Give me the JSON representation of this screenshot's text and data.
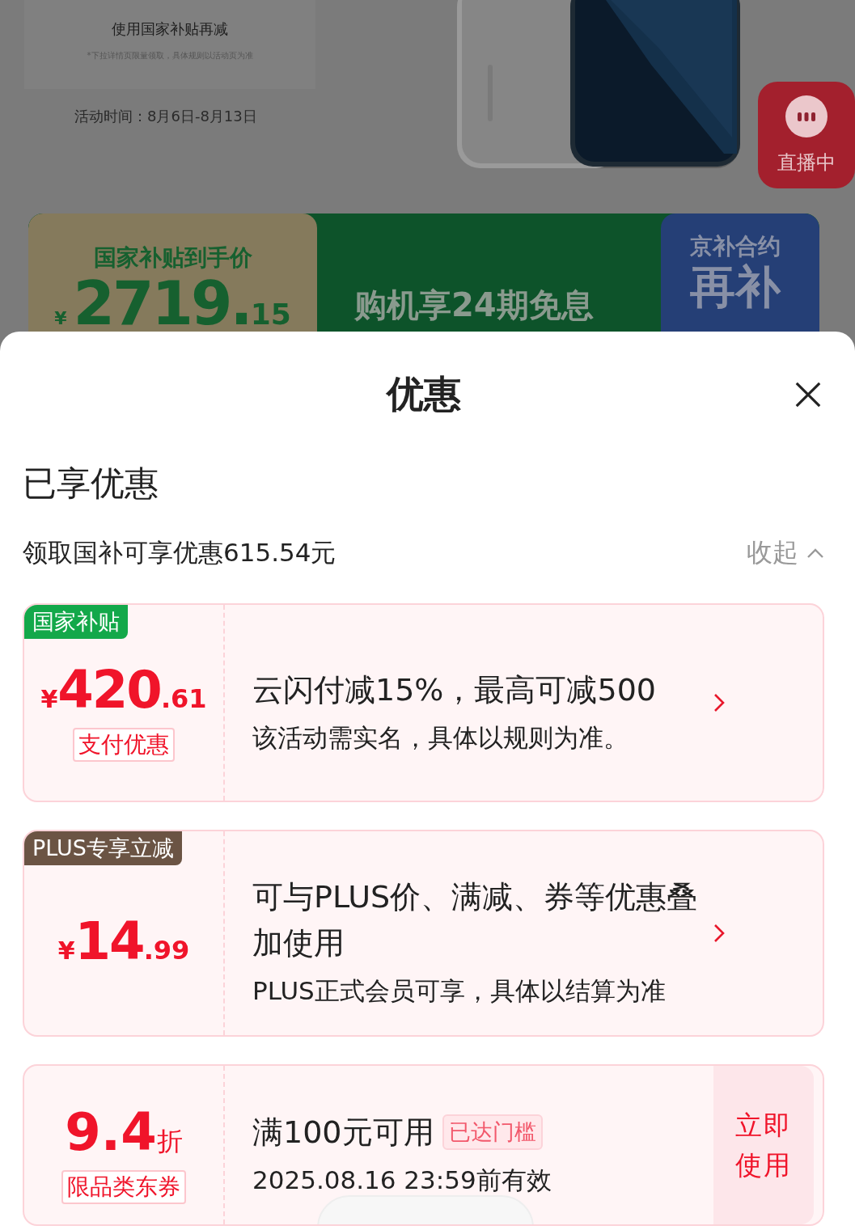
{
  "backdrop": {
    "promo_subtitle": "使用国家补贴再减",
    "promo_note": "*下拉详情页限量领取，具体规则以活动页为准",
    "promo_period": "活动时间：8月6日-8月13日",
    "live_button": {
      "label": "直播中"
    },
    "subsidy_banner": {
      "label": "国家补贴到手价",
      "currency": "¥",
      "price_int": "2719.",
      "price_dec": "15"
    },
    "installment_text": "购机享24期免息",
    "contract_badge": {
      "line1": "京补合约",
      "line2": "再补"
    }
  },
  "sheet": {
    "title": "优惠",
    "section_title": "已享优惠",
    "summary": {
      "text": "领取国补可享优惠615.54元",
      "toggle_label": "收起",
      "expanded": true
    },
    "offers": [
      {
        "tag": "国家补贴",
        "color": "#13a84a",
        "currency": "¥",
        "amount_int": "420",
        "amount_dec": ".61",
        "type_label": "支付优惠",
        "title": "云闪付减15%，最高可减500",
        "subtitle": "该活动需实名，具体以规则为准。"
      },
      {
        "tag": "PLUS专享立减",
        "color": "#6b5444",
        "currency": "¥",
        "amount_int": "14",
        "amount_dec": ".99",
        "title": "可与PLUS价、满减、券等优惠叠加使用",
        "subtitle": "PLUS正式会员可享，具体以结算为准"
      }
    ],
    "coupon": {
      "rate": "9.4",
      "rate_unit": "折",
      "category": "限品类东券",
      "condition": "满100元可用",
      "status_badge": "已达门槛",
      "expiry": "2025.08.16 23:59前有效",
      "action": "立即使用"
    }
  }
}
